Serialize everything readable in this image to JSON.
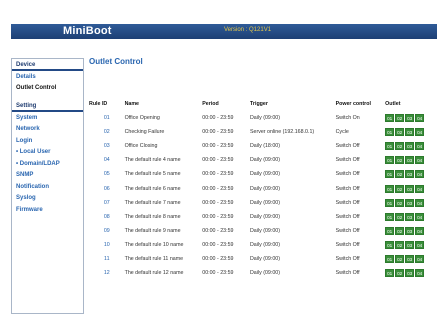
{
  "header": {
    "brand": "MiniBoot",
    "version": "Version : Q121V1"
  },
  "sidebar": {
    "sections": [
      {
        "title": "Device",
        "items": [
          {
            "label": "Details",
            "active": false
          },
          {
            "label": "Outlet Control",
            "active": true
          }
        ]
      },
      {
        "title": "Setting",
        "items": [
          {
            "label": "System",
            "active": false
          },
          {
            "label": "Network",
            "active": false
          },
          {
            "label": "Login",
            "active": false
          },
          {
            "label": "•  Local User",
            "active": false
          },
          {
            "label": "•  Domain/LDAP",
            "active": false
          },
          {
            "label": "SNMP",
            "active": false
          },
          {
            "label": "Notification",
            "active": false
          },
          {
            "label": "Syslog",
            "active": false
          },
          {
            "label": "Firmware",
            "active": false
          }
        ]
      }
    ]
  },
  "page": {
    "title": "Outlet Control"
  },
  "table": {
    "headers": [
      "Rule ID",
      "Name",
      "Period",
      "Trigger",
      "Power control",
      "Outlet"
    ],
    "outlet_labels": [
      "01",
      "02",
      "03",
      "04"
    ],
    "rows": [
      {
        "id": "01",
        "name": "Office Opening",
        "period": "00:00 - 23:59",
        "trigger": "Daily (09:00)",
        "power": "Switch On",
        "outlets": [
          true,
          true,
          true,
          true
        ]
      },
      {
        "id": "02",
        "name": "Checking Failure",
        "period": "00:00 - 23:59",
        "trigger": "Server online (192.168.0.1)",
        "power": "Cycle",
        "outlets": [
          true,
          true,
          true,
          true
        ]
      },
      {
        "id": "03",
        "name": "Office Closing",
        "period": "00:00 - 23:59",
        "trigger": "Daily (18:00)",
        "power": "Switch Off",
        "outlets": [
          true,
          true,
          true,
          true
        ]
      },
      {
        "id": "04",
        "name": "The default rule 4 name",
        "period": "00:00 - 23:59",
        "trigger": "Daily (09:00)",
        "power": "Switch Off",
        "outlets": [
          true,
          true,
          true,
          true
        ]
      },
      {
        "id": "05",
        "name": "The default rule 5 name",
        "period": "00:00 - 23:59",
        "trigger": "Daily (09:00)",
        "power": "Switch Off",
        "outlets": [
          true,
          true,
          true,
          true
        ]
      },
      {
        "id": "06",
        "name": "The default rule 6 name",
        "period": "00:00 - 23:59",
        "trigger": "Daily (09:00)",
        "power": "Switch Off",
        "outlets": [
          true,
          true,
          true,
          true
        ]
      },
      {
        "id": "07",
        "name": "The default rule 7 name",
        "period": "00:00 - 23:59",
        "trigger": "Daily (09:00)",
        "power": "Switch Off",
        "outlets": [
          true,
          true,
          true,
          true
        ]
      },
      {
        "id": "08",
        "name": "The default rule 8 name",
        "period": "00:00 - 23:59",
        "trigger": "Daily (09:00)",
        "power": "Switch Off",
        "outlets": [
          true,
          true,
          true,
          true
        ]
      },
      {
        "id": "09",
        "name": "The default rule 9 name",
        "period": "00:00 - 23:59",
        "trigger": "Daily (09:00)",
        "power": "Switch Off",
        "outlets": [
          true,
          true,
          true,
          true
        ]
      },
      {
        "id": "10",
        "name": "The default rule 10 name",
        "period": "00:00 - 23:59",
        "trigger": "Daily (09:00)",
        "power": "Switch Off",
        "outlets": [
          true,
          true,
          true,
          true
        ]
      },
      {
        "id": "11",
        "name": "The default rule 11 name",
        "period": "00:00 - 23:59",
        "trigger": "Daily (09:00)",
        "power": "Switch Off",
        "outlets": [
          true,
          true,
          true,
          true
        ]
      },
      {
        "id": "12",
        "name": "The default rule 12 name",
        "period": "00:00 - 23:59",
        "trigger": "Daily (09:00)",
        "power": "Switch Off",
        "outlets": [
          true,
          true,
          true,
          true
        ]
      }
    ]
  },
  "colors": {
    "header_bg": "#1d3f74",
    "link": "#2a66b0",
    "outlet_on": "#3a8f3a",
    "version_text": "#e6c94a"
  }
}
